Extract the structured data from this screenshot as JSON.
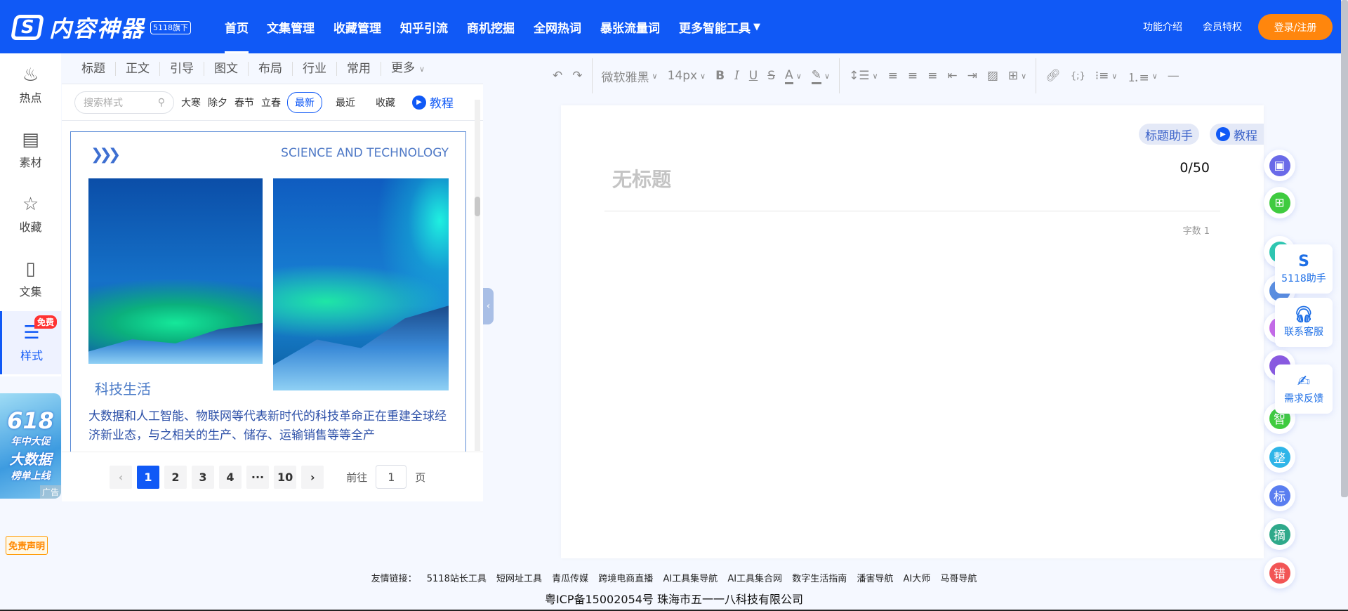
{
  "header": {
    "logo_text": "内容神器",
    "logo_sub": "5118旗下",
    "nav": [
      "首页",
      "文集管理",
      "收藏管理",
      "知乎引流",
      "商机挖掘",
      "全网热词",
      "暴张流量词",
      "更多智能工具"
    ],
    "active_nav": "首页",
    "links": [
      "功能介绍",
      "会员特权"
    ],
    "login": "登录/注册"
  },
  "sidebar": {
    "items": [
      {
        "label": "热点",
        "icon": "fire-icon"
      },
      {
        "label": "素材",
        "icon": "inbox-icon"
      },
      {
        "label": "收藏",
        "icon": "star-document-icon"
      },
      {
        "label": "文集",
        "icon": "document-icon"
      },
      {
        "label": "样式",
        "icon": "layout-icon",
        "badge": "免费",
        "active": true
      }
    ],
    "ad": {
      "l1": "618",
      "l2": "年中大促",
      "l3": "大数据",
      "l4": "榜单上线",
      "tag": "广告"
    },
    "disclaimer": "免责声明"
  },
  "panel": {
    "tabs": [
      "标题",
      "正文",
      "引导",
      "图文",
      "布局",
      "行业",
      "常用",
      "更多"
    ],
    "search_placeholder": "搜索样式",
    "keywords": [
      "大寒",
      "除夕",
      "春节",
      "立春"
    ],
    "filters": [
      "最新",
      "最近",
      "收藏"
    ],
    "active_filter": "最新",
    "tutorial": "教程",
    "card": {
      "header": "SCIENCE AND TECHNOLOGY",
      "title": "科技生活",
      "body": "大数据和人工智能、物联网等代表新时代的科技革命正在重建全球经济新业态，与之相关的生产、储存、运输销售等等全产"
    },
    "pagination": {
      "pages": [
        "1",
        "2",
        "3",
        "4",
        "···",
        "10"
      ],
      "current": "1",
      "goto_label": "前往",
      "goto_value": "1",
      "page_suffix": "页"
    }
  },
  "toolbar": {
    "font": "微软雅黑",
    "size": "14px"
  },
  "editor": {
    "title_helper": "标题助手",
    "tutorial": "教程",
    "title_placeholder": "无标题",
    "title_count": "0/50",
    "word_count": "字数 1"
  },
  "float_buttons": [
    {
      "label": "",
      "color": "#6a6ae8",
      "icon": "save-icon"
    },
    {
      "label": "",
      "color": "#3fcb3f",
      "icon": "add-document-icon"
    },
    {
      "label": "",
      "color": "#2ec9b0"
    },
    {
      "label": "",
      "color": "#5b8fe0"
    },
    {
      "label": "",
      "color": "#c86be8"
    },
    {
      "label": "",
      "color": "#8a5ae0"
    },
    {
      "label": "智",
      "color": "#3fcb3f"
    },
    {
      "label": "整",
      "color": "#2fb5e8"
    },
    {
      "label": "标",
      "color": "#5a7ef0"
    },
    {
      "label": "摘",
      "color": "#2fa98a"
    },
    {
      "label": "错",
      "color": "#f25555"
    }
  ],
  "help_cards": [
    {
      "label": "5118助手",
      "icon": "5118-logo-icon"
    },
    {
      "label": "联系客服",
      "icon": "headset-icon"
    },
    {
      "label": "需求反馈",
      "icon": "feedback-icon"
    }
  ],
  "footer": {
    "links_label": "友情链接：",
    "links": [
      "5118站长工具",
      "短网址工具",
      "青瓜传媒",
      "跨境电商直播",
      "AI工具集导航",
      "AI工具集合网",
      "数字生活指南",
      "潘害导航",
      "AI大师",
      "马哥导航"
    ],
    "icp": "粤ICP备15002054号 珠海市五一一八科技有限公司"
  }
}
